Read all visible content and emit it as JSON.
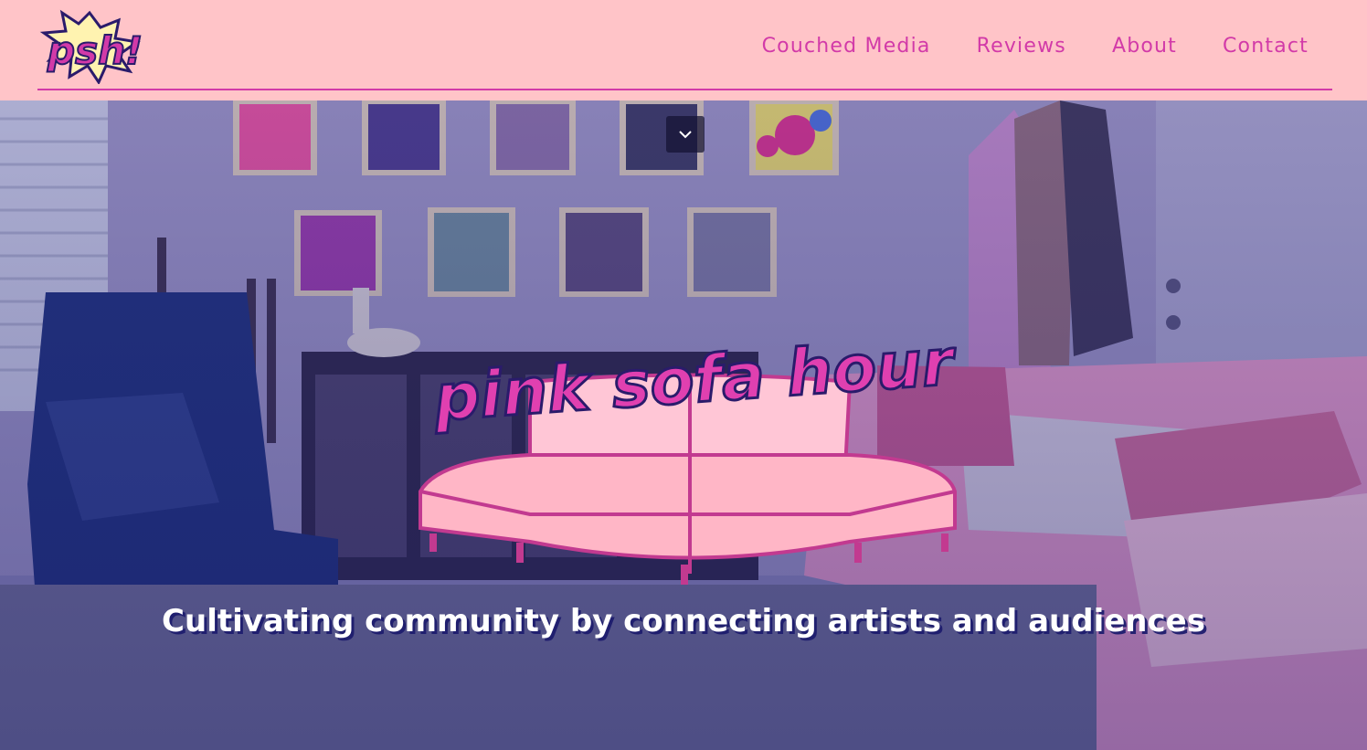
{
  "header": {
    "logo_text": "psh!",
    "nav": [
      {
        "label": "Couched Media"
      },
      {
        "label": "Reviews"
      },
      {
        "label": "About"
      },
      {
        "label": "Contact"
      }
    ]
  },
  "hero": {
    "brand_title": "pink sofa hour",
    "tagline": "Cultivating community by connecting artists and audiences"
  },
  "colors": {
    "header_bg": "#ffc4c8",
    "accent": "#d23aa8",
    "sofa": "#ffb6c6"
  },
  "icons": {
    "scroll_down": "chevron-down-icon"
  }
}
